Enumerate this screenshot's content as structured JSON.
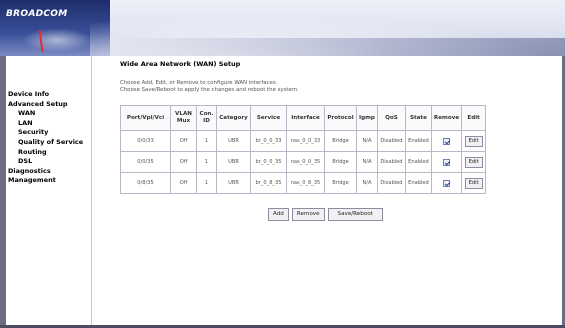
{
  "brand": {
    "logo_text": "BROADCOM"
  },
  "sidebar": {
    "items": [
      {
        "label": "Device Info",
        "level": 1
      },
      {
        "label": "Advanced Setup",
        "level": 1
      },
      {
        "label": "WAN",
        "level": 2
      },
      {
        "label": "LAN",
        "level": 2
      },
      {
        "label": "Security",
        "level": 2
      },
      {
        "label": "Quality of Service",
        "level": 2
      },
      {
        "label": "Routing",
        "level": 2
      },
      {
        "label": "DSL",
        "level": 2
      },
      {
        "label": "Diagnostics",
        "level": 1
      },
      {
        "label": "Management",
        "level": 1
      }
    ]
  },
  "main": {
    "title": "Wide Area Network (WAN) Setup",
    "desc_line1": "Choose Add, Edit, or Remove to configure WAN interfaces.",
    "desc_line2": "Choose Save/Reboot to apply the changes and reboot the system.",
    "table": {
      "headers": {
        "port": "Port/Vpi/Vci",
        "vlan": "VLAN Mux",
        "con": "Con. ID",
        "category": "Category",
        "service": "Service",
        "interface": "Interface",
        "protocol": "Protocol",
        "igmp": "Igmp",
        "qos": "QoS",
        "state": "State",
        "remove": "Remove",
        "edit": "Edit"
      },
      "rows": [
        {
          "port": "0/0/33",
          "vlan": "Off",
          "con": "1",
          "category": "UBR",
          "service": "br_0_0_33",
          "interface": "nas_0_0_33",
          "protocol": "Bridge",
          "igmp": "N/A",
          "qos": "Disabled",
          "state": "Enabled",
          "remove_checked": true,
          "edit_label": "Edit"
        },
        {
          "port": "0/0/35",
          "vlan": "Off",
          "con": "1",
          "category": "UBR",
          "service": "br_0_0_35",
          "interface": "nas_0_0_35",
          "protocol": "Bridge",
          "igmp": "N/A",
          "qos": "Disabled",
          "state": "Enabled",
          "remove_checked": true,
          "edit_label": "Edit"
        },
        {
          "port": "0/8/35",
          "vlan": "Off",
          "con": "1",
          "category": "UBR",
          "service": "br_0_8_35",
          "interface": "nas_0_8_35",
          "protocol": "Bridge",
          "igmp": "N/A",
          "qos": "Disabled",
          "state": "Enabled",
          "remove_checked": true,
          "edit_label": "Edit"
        }
      ]
    },
    "buttons": {
      "add": "Add",
      "remove": "Remove",
      "save_reboot": "Save/Reboot"
    }
  },
  "colors": {
    "header_dark": "#1d2c6b",
    "frame": "#6c6c84",
    "table_border": "#b8b8c8"
  }
}
